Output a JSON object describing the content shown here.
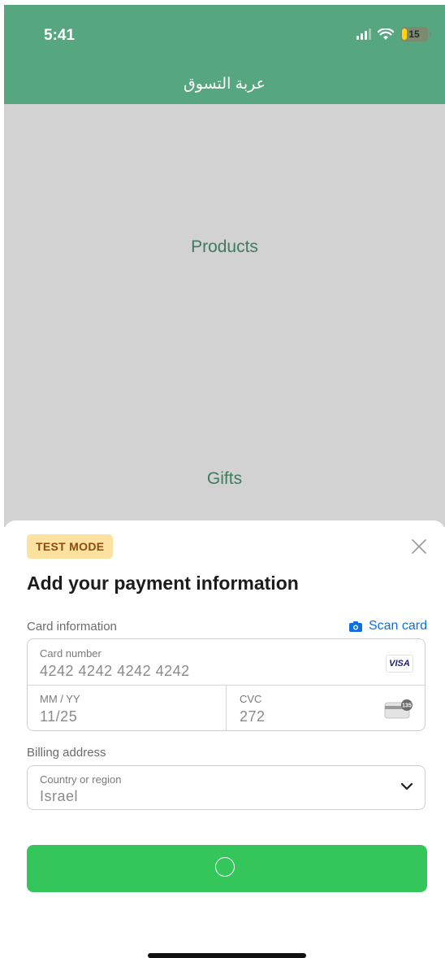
{
  "status_bar": {
    "time": "5:41",
    "battery": "15"
  },
  "header": {
    "title": "عربة التسوق"
  },
  "nav": {
    "products": "Products",
    "gifts": "Gifts"
  },
  "sheet": {
    "badge": "TEST MODE",
    "title": "Add your payment information",
    "card_section_label": "Card information",
    "scan_card": "Scan card",
    "card_number": {
      "label": "Card number",
      "value": "4242 4242 4242 4242"
    },
    "card_brand": "VISA",
    "expiry": {
      "label": "MM / YY",
      "value": "11/25"
    },
    "cvc": {
      "label": "CVC",
      "value": "272",
      "icon_number": "135"
    },
    "billing_label": "Billing address",
    "country": {
      "label": "Country or region",
      "value": "Israel"
    }
  },
  "colors": {
    "header": "#56a67f",
    "content_bg": "#d2d2d2",
    "nav_text": "#3f7b5c",
    "pay_button": "#34c65a",
    "link": "#0d6fe3",
    "badge_bg": "#fde1a0"
  },
  "icons": [
    "signal-icon",
    "wifi-icon",
    "battery-icon",
    "close-icon",
    "camera-icon",
    "visa-icon",
    "cvc-card-icon",
    "chevron-down-icon",
    "loading-spinner"
  ]
}
